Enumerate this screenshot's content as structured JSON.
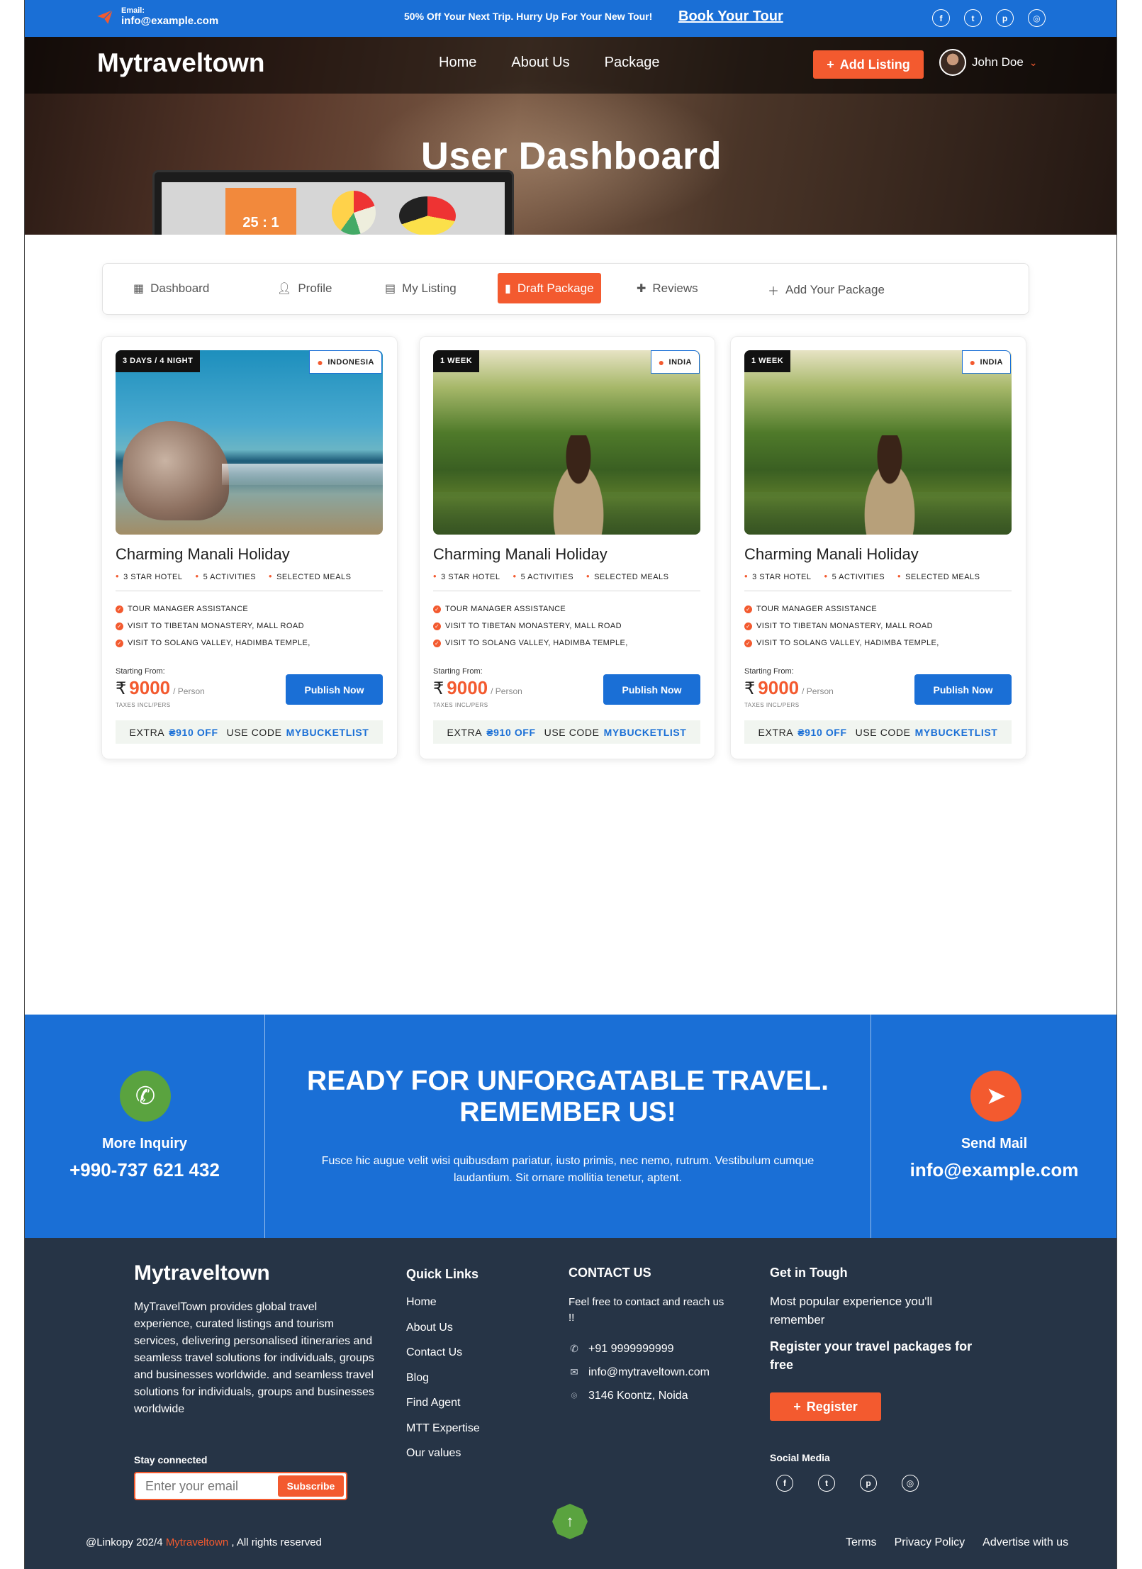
{
  "topbar": {
    "email_label": "Email:",
    "email_value": "info@example.com",
    "promo": "50% Off Your Next Trip. Hurry Up For Your New Tour!",
    "book_link": "Book Your Tour",
    "socials": [
      "facebook-icon",
      "twitter-icon",
      "pinterest-icon",
      "instagram-icon"
    ]
  },
  "nav": {
    "brand": "Mytraveltown",
    "links": [
      "Home",
      "About Us",
      "Package"
    ],
    "add_listing": "Add Listing",
    "user_name": "John Doe"
  },
  "hero": {
    "title": "User Dashboard",
    "screen_text": "25 : 1"
  },
  "tabs": [
    {
      "label": "Dashboard",
      "icon": "dashboard-icon",
      "active": false
    },
    {
      "label": "Profile",
      "icon": "user-icon",
      "active": false
    },
    {
      "label": "My Listing",
      "icon": "list-icon",
      "active": false
    },
    {
      "label": "Draft Package",
      "icon": "document-icon",
      "active": true
    },
    {
      "label": "Reviews",
      "icon": "review-icon",
      "active": false
    },
    {
      "label": "Add Your Package",
      "icon": "plus-icon",
      "active": false
    }
  ],
  "cards": [
    {
      "duration": "3 DAYS / 4 NIGHT",
      "location": "INDONESIA",
      "title": "Charming Manali Holiday",
      "features": [
        "3 STAR HOTEL",
        "5 ACTIVITIES",
        "SELECTED MEALS"
      ],
      "inclusions": [
        "TOUR MANAGER ASSISTANCE",
        "VISIT TO TIBETAN MONASTERY, MALL ROAD",
        "VISIT TO SOLANG VALLEY, HADIMBA TEMPLE,"
      ],
      "starting_from": "Starting From:",
      "currency": "₹",
      "price": "9000",
      "per": "/ Person",
      "taxes": "TAXES INCL/PERS",
      "publish": "Publish Now",
      "offer_extra": "EXTRA",
      "offer_amount": "₴910 OFF",
      "offer_use": "USE CODE",
      "offer_code": "MYBUCKETLIST"
    },
    {
      "duration": "1 WEEK",
      "location": "INDIA",
      "title": "Charming Manali Holiday",
      "features": [
        "3 STAR HOTEL",
        "5 ACTIVITIES",
        "SELECTED MEALS"
      ],
      "inclusions": [
        "TOUR MANAGER ASSISTANCE",
        "VISIT TO TIBETAN MONASTERY, MALL ROAD",
        "VISIT TO SOLANG VALLEY, HADIMBA TEMPLE,"
      ],
      "starting_from": "Starting From:",
      "currency": "₹",
      "price": "9000",
      "per": "/ Person",
      "taxes": "TAXES INCL/PERS",
      "publish": "Publish Now",
      "offer_extra": "EXTRA",
      "offer_amount": "₴910 OFF",
      "offer_use": "USE CODE",
      "offer_code": "MYBUCKETLIST"
    },
    {
      "duration": "1 WEEK",
      "location": "INDIA",
      "title": "Charming Manali Holiday",
      "features": [
        "3 STAR HOTEL",
        "5 ACTIVITIES",
        "SELECTED MEALS"
      ],
      "inclusions": [
        "TOUR MANAGER ASSISTANCE",
        "VISIT TO TIBETAN MONASTERY, MALL ROAD",
        "VISIT TO SOLANG VALLEY, HADIMBA TEMPLE,"
      ],
      "starting_from": "Starting From:",
      "currency": "₹",
      "price": "9000",
      "per": "/ Person",
      "taxes": "TAXES INCL/PERS",
      "publish": "Publish Now",
      "offer_extra": "EXTRA",
      "offer_amount": "₴910 OFF",
      "offer_use": "USE CODE",
      "offer_code": "MYBUCKETLIST"
    }
  ],
  "cta": {
    "inquiry_label": "More Inquiry",
    "inquiry_phone": "+990-737 621 432",
    "headline": "READY FOR UNFORGATABLE TRAVEL. REMEMBER US!",
    "subtext": "Fusce hic augue velit wisi quibusdam pariatur, iusto primis, nec nemo, rutrum. Vestibulum cumque laudantium. Sit ornare mollitia tenetur, aptent.",
    "mail_label": "Send Mail",
    "mail_value": "info@example.com"
  },
  "footer": {
    "brand": "Mytraveltown",
    "about": "MyTravelTown provides global travel experience, curated listings and tourism services, delivering personalised itineraries and seamless travel solutions for individuals, groups and businesses worldwide.  and seamless travel solutions for individuals, groups and businesses worldwide",
    "stay_connected": "Stay connected",
    "email_placeholder": "Enter your email",
    "subscribe": "Subscribe",
    "quick_links_title": "Quick Links",
    "quick_links": [
      "Home",
      "About Us",
      "Contact Us",
      "Blog",
      "Find Agent",
      "MTT Expertise",
      "Our values"
    ],
    "contact_title": "CONTACT US",
    "contact_text": "Feel free to contact and reach us !!",
    "phone": "+91 9999999999",
    "email": "info@mytraveltown.com",
    "address": "3146 Koontz, Noida",
    "tough_title": "Get in Tough",
    "tough_text": "Most popular experience you'll remember",
    "register_text": "Register your travel packages for free",
    "register_button": "Register",
    "social_media": "Social Media",
    "copyright_prefix": "@Linkopy 202/4",
    "copyright_brand": "Mytraveltown",
    "copyright_suffix": ", All rights reserved",
    "bottom_links": [
      "Terms",
      "Privacy Policy",
      "Advertise with us"
    ]
  }
}
